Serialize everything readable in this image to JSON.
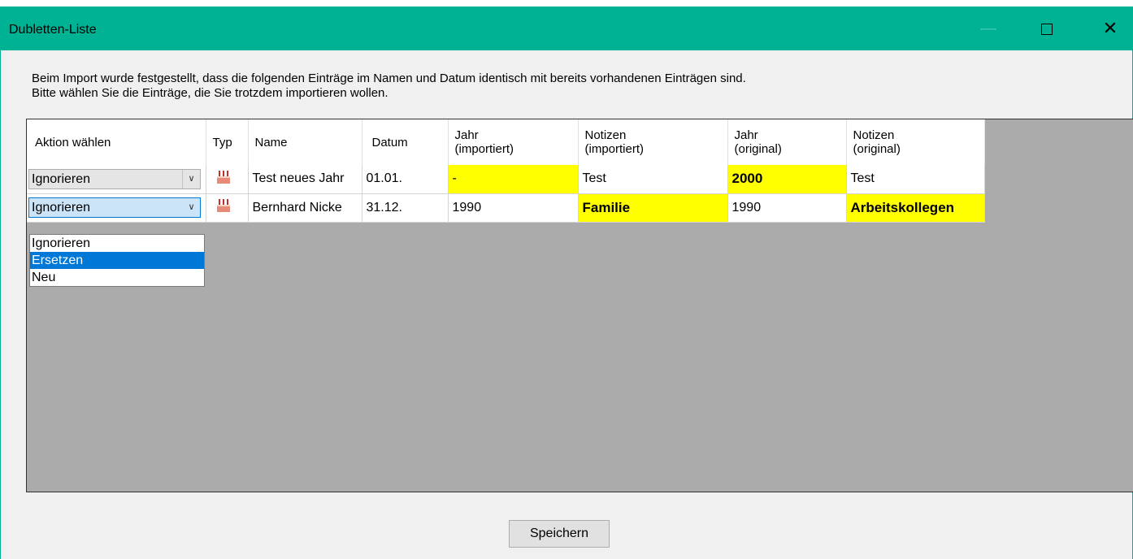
{
  "window": {
    "title": "Dubletten-Liste",
    "accent": "#00b294"
  },
  "message": {
    "line1": "Beim Import wurde festgestellt, dass die folgenden Einträge im Namen und Datum identisch mit bereits vorhandenen Einträgen sind.",
    "line2": "Bitte wählen Sie die Einträge, die Sie trotzdem importieren wollen."
  },
  "table": {
    "headers": {
      "aktion": "Aktion wählen",
      "typ": "Typ",
      "name": "Name",
      "datum": "Datum",
      "jahr_imp_1": "Jahr",
      "jahr_imp_2": "(importiert)",
      "not_imp_1": "Notizen",
      "not_imp_2": "(importiert)",
      "jahr_org_1": "Jahr",
      "jahr_org_2": "(original)",
      "not_org_1": "Notizen",
      "not_org_2": "(original)"
    },
    "rows": [
      {
        "aktion": "Ignorieren",
        "typ_icon": "birthday-cake-icon",
        "name": "Test neues Jahr",
        "datum": "01.01.",
        "jahr_imp": "-",
        "notizen_imp": "Test",
        "jahr_org": "2000",
        "notizen_org": "Test"
      },
      {
        "aktion": "Ignorieren",
        "typ_icon": "birthday-cake-icon",
        "name": "Bernhard Nicke",
        "datum": "31.12.",
        "jahr_imp": "1990",
        "notizen_imp": "Familie",
        "jahr_org": "1990",
        "notizen_org": "Arbeitskollegen"
      }
    ],
    "highlight_color": "#ffff00"
  },
  "dropdown": {
    "options": [
      "Ignorieren",
      "Ersetzen",
      "Neu"
    ],
    "highlighted": "Ersetzen"
  },
  "save_label": "Speichern"
}
